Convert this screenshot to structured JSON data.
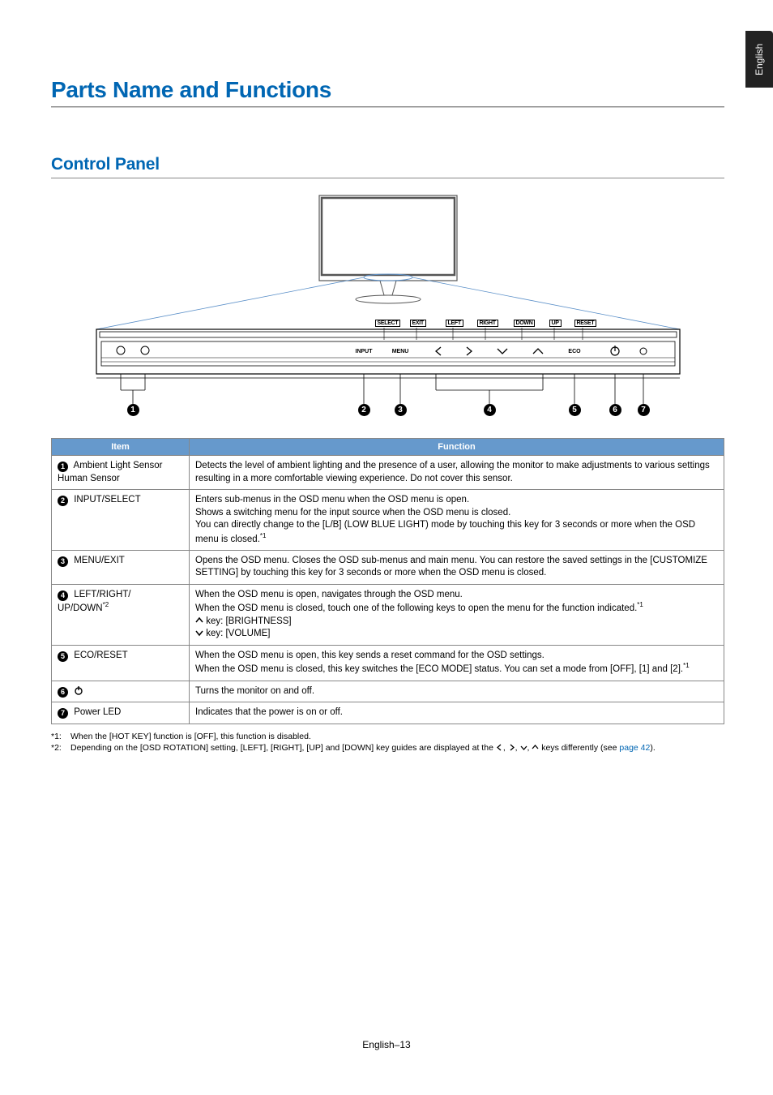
{
  "lang_tab": "English",
  "title": "Parts Name and Functions",
  "subtitle": "Control Panel",
  "diagram": {
    "top_labels": [
      "SELECT",
      "EXIT",
      "LEFT",
      "RIGHT",
      "DOWN",
      "UP",
      "RESET"
    ],
    "key_labels": [
      "INPUT",
      "MENU",
      "ECO"
    ],
    "callout_numbers": [
      "1",
      "2",
      "3",
      "4",
      "5",
      "6",
      "7"
    ]
  },
  "table": {
    "head_item": "Item",
    "head_function": "Function",
    "rows": [
      {
        "num": "1",
        "item_html": "Ambient Light Sensor<br>Human Sensor",
        "func_html": "Detects the level of ambient lighting and the presence of a user, allowing the monitor to make adjustments to various settings resulting in a more comfortable viewing experience. Do not cover this sensor."
      },
      {
        "num": "2",
        "item_html": "INPUT/SELECT",
        "func_html": "Enters sub-menus in the OSD menu when the OSD menu is open.<br>Shows a switching menu for the input source when the OSD menu is closed.<br>You can directly change to the [L/B] (LOW BLUE LIGHT) mode by touching this key for 3 seconds or more when the OSD menu is closed.<sup>*1</sup>"
      },
      {
        "num": "3",
        "item_html": "MENU/EXIT",
        "func_html": "Opens the OSD menu. Closes the OSD sub-menus and main menu. You can restore the saved settings in the [CUSTOMIZE SETTING] by touching this key for 3 seconds or more when the OSD menu is closed."
      },
      {
        "num": "4",
        "item_html": "LEFT/RIGHT/<br>UP/DOWN<sup>*2</sup>",
        "func_html": "When the OSD menu is open, navigates through the OSD menu.<br>When the OSD menu is closed, touch one of the following keys to open the menu for the function indicated.<sup>*1</sup><br><svg width=\"10\" height=\"10\" style=\"vertical-align:-1px\"><path d=\"M1 7 L5 2 L9 7\" stroke=\"#000\" stroke-width=\"1.5\" fill=\"none\"/></svg> key: [BRIGHTNESS]<br><svg width=\"10\" height=\"10\" style=\"vertical-align:-1px\"><path d=\"M1 3 L5 8 L9 3\" stroke=\"#000\" stroke-width=\"1.5\" fill=\"none\"/></svg> key: [VOLUME]"
      },
      {
        "num": "5",
        "item_html": "ECO/RESET",
        "func_html": "When the OSD menu is open, this key sends a reset command for the OSD settings.<br>When the OSD menu is closed, this key switches the [ECO MODE] status. You can set a mode from [OFF], [1] and [2].<sup>*1</sup>"
      },
      {
        "num": "6",
        "item_html": "<svg width=\"12\" height=\"12\" style=\"vertical-align:-2px\"><circle cx=\"6\" cy=\"7\" r=\"4\" stroke=\"#000\" stroke-width=\"1.4\" fill=\"none\"/><line x1=\"6\" y1=\"1\" x2=\"6\" y2=\"6\" stroke=\"#000\" stroke-width=\"1.4\"/></svg>",
        "func_html": "Turns the monitor on and off."
      },
      {
        "num": "7",
        "item_html": "Power LED",
        "func_html": "Indicates that the power is on or off."
      }
    ]
  },
  "footnotes": {
    "f1_label": "*1:",
    "f1_text": "When the [HOT KEY] function is [OFF], this function is disabled.",
    "f2_label": "*2:",
    "f2_prefix": "Depending on the [OSD ROTATION] setting, [LEFT], [RIGHT], [UP] and [DOWN] key guides are displayed at the ",
    "f2_suffix": " keys differently (see ",
    "f2_link": "page 42",
    "f2_end": ")."
  },
  "page_number": "English–13"
}
